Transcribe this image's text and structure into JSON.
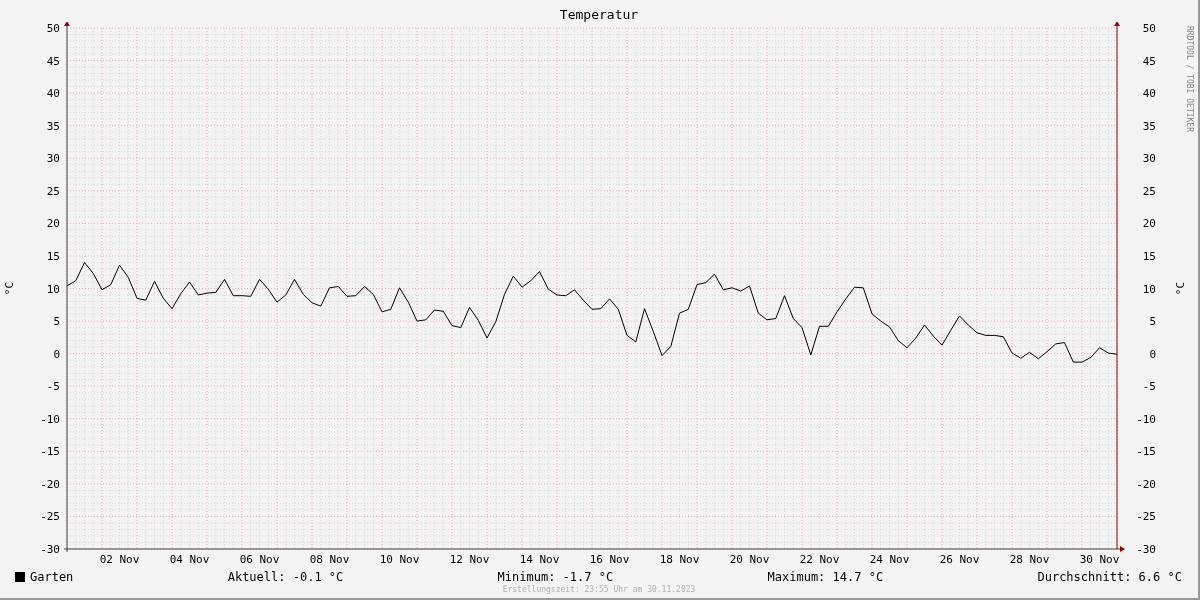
{
  "y_unit_right": "°C",
  "right_axis_labels": [
    "50",
    "45",
    "40",
    "35",
    "30",
    "25",
    "20",
    "15",
    "10",
    "5",
    "0",
    "-5",
    "-10",
    "-15",
    "-20",
    "-25",
    "-30"
  ],
  "watermark": "RRDTOOL / TOBI OETIKER",
  "chart_data": {
    "type": "line",
    "title": "Temperatur",
    "ylabel": "°C",
    "grid": true,
    "ylim": [
      -30,
      50
    ],
    "yticks": [
      -30,
      -25,
      -20,
      -15,
      -10,
      -5,
      0,
      5,
      10,
      15,
      20,
      25,
      30,
      35,
      40,
      45,
      50
    ],
    "categories": [
      null,
      null,
      null,
      null,
      null,
      null,
      "02 Nov",
      null,
      null,
      null,
      null,
      null,
      null,
      null,
      "04 Nov",
      null,
      null,
      null,
      null,
      null,
      null,
      null,
      "06 Nov",
      null,
      null,
      null,
      null,
      null,
      null,
      null,
      "08 Nov",
      null,
      null,
      null,
      null,
      null,
      null,
      null,
      "10 Nov",
      null,
      null,
      null,
      null,
      null,
      null,
      null,
      "12 Nov",
      null,
      null,
      null,
      null,
      null,
      null,
      null,
      "14 Nov",
      null,
      null,
      null,
      null,
      null,
      null,
      null,
      "16 Nov",
      null,
      null,
      null,
      null,
      null,
      null,
      null,
      "18 Nov",
      null,
      null,
      null,
      null,
      null,
      null,
      null,
      "20 Nov",
      null,
      null,
      null,
      null,
      null,
      null,
      null,
      "22 Nov",
      null,
      null,
      null,
      null,
      null,
      null,
      null,
      "24 Nov",
      null,
      null,
      null,
      null,
      null,
      null,
      null,
      "26 Nov",
      null,
      null,
      null,
      null,
      null,
      null,
      null,
      "28 Nov",
      null,
      null,
      null,
      null,
      null,
      null,
      null,
      "30 Nov",
      null,
      null
    ],
    "series": [
      {
        "name": "Garten",
        "color": "#000000",
        "values": [
          10.4,
          11.2,
          14.0,
          12.3,
          9.8,
          10.6,
          13.6,
          11.7,
          8.5,
          8.2,
          11.1,
          8.5,
          6.9,
          9.2,
          11.0,
          9.0,
          9.3,
          9.4,
          11.4,
          8.9,
          8.9,
          8.8,
          11.4,
          9.9,
          7.9,
          9.0,
          11.4,
          9.1,
          7.8,
          7.3,
          10.1,
          10.3,
          8.8,
          8.9,
          10.3,
          9.1,
          6.4,
          6.8,
          10.1,
          7.9,
          5.0,
          5.2,
          6.7,
          6.5,
          4.3,
          4.0,
          7.1,
          5.1,
          2.4,
          4.9,
          9.1,
          11.9,
          10.2,
          11.2,
          12.6,
          9.9,
          9.0,
          8.9,
          9.8,
          8.2,
          6.8,
          6.9,
          8.4,
          6.8,
          2.8,
          1.8,
          6.9,
          3.4,
          -0.3,
          1.1,
          6.2,
          6.8,
          10.6,
          10.9,
          12.2,
          9.8,
          10.1,
          9.6,
          10.4,
          6.2,
          5.2,
          5.4,
          8.9,
          5.4,
          4.0,
          -0.2,
          4.2,
          4.2,
          6.4,
          8.4,
          10.2,
          10.1,
          6.1,
          5.0,
          4.1,
          2.0,
          0.9,
          2.4,
          4.4,
          2.7,
          1.3,
          3.6,
          5.8,
          4.4,
          3.2,
          2.8,
          2.8,
          2.6,
          0.1,
          -0.7,
          0.2,
          -0.8,
          0.3,
          1.5,
          1.7,
          -1.3,
          -1.3,
          -0.6,
          0.9,
          0.1,
          -0.1
        ]
      }
    ]
  },
  "legend": {
    "stats": [
      "Aktuell: -0.1 °C",
      "Minimum: -1.7 °C",
      "Maximum: 14.7 °C",
      "Durchschnitt: 6.6 °C"
    ]
  },
  "footer": "Erstellungszeit: 23:55 Uhr am 30.11.2023"
}
